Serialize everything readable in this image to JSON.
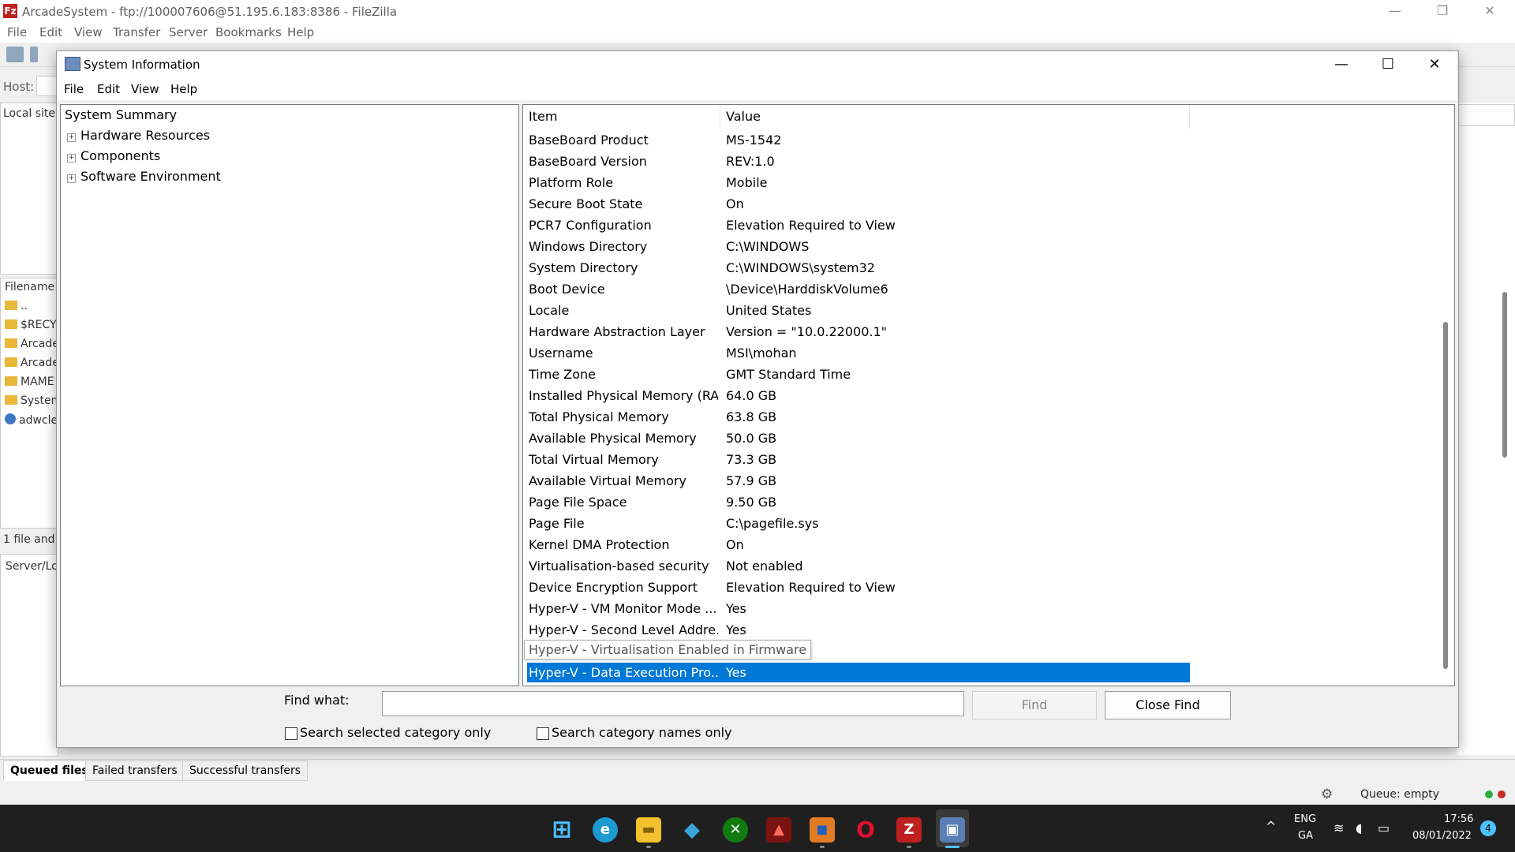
{
  "filezilla": {
    "title": "ArcadeSystem - ftp://100007606@51.195.6.183:8386 - FileZilla",
    "logo": "Fz",
    "window_controls": [
      "—",
      "❐",
      "✕"
    ],
    "menu": [
      "File",
      "Edit",
      "View",
      "Transfer",
      "Server",
      "Bookmarks",
      "Help"
    ],
    "host_label": "Host:",
    "local_site_label": "Local site:",
    "filename_header": "Filename",
    "files": [
      "..",
      "$RECYC",
      "Arcade",
      "Arcade",
      "MAME",
      "System",
      "adwcle"
    ],
    "status_left": "1 file and",
    "server_local_label": "Server/Lo",
    "transfer_tabs": [
      "Queued files",
      "Failed transfers",
      "Successful transfers"
    ],
    "queue_status": "Queue: empty",
    "queue_icon": "gear-icon",
    "led_colors": [
      "#2eae3f",
      "#c62828"
    ]
  },
  "sysinfo": {
    "title": "System Information",
    "window_controls": [
      "—",
      "☐",
      "✕"
    ],
    "menu": [
      "File",
      "Edit",
      "View",
      "Help"
    ],
    "tree": {
      "root": "System Summary",
      "children": [
        "Hardware Resources",
        "Components",
        "Software Environment"
      ],
      "expander": "+"
    },
    "columns": {
      "item": "Item",
      "value": "Value"
    },
    "rows": [
      {
        "item": "BaseBoard Product",
        "value": "MS-1542"
      },
      {
        "item": "BaseBoard Version",
        "value": "REV:1.0"
      },
      {
        "item": "Platform Role",
        "value": "Mobile"
      },
      {
        "item": "Secure Boot State",
        "value": "On"
      },
      {
        "item": "PCR7 Configuration",
        "value": "Elevation Required to View"
      },
      {
        "item": "Windows Directory",
        "value": "C:\\WINDOWS"
      },
      {
        "item": "System Directory",
        "value": "C:\\WINDOWS\\system32"
      },
      {
        "item": "Boot Device",
        "value": "\\Device\\HarddiskVolume6"
      },
      {
        "item": "Locale",
        "value": "United States"
      },
      {
        "item": "Hardware Abstraction Layer",
        "value": "Version = \"10.0.22000.1\""
      },
      {
        "item": "Username",
        "value": "MSI\\mohan"
      },
      {
        "item": "Time Zone",
        "value": "GMT Standard Time"
      },
      {
        "item": "Installed Physical Memory (RA...",
        "value": "64.0 GB"
      },
      {
        "item": "Total Physical Memory",
        "value": "63.8 GB"
      },
      {
        "item": "Available Physical Memory",
        "value": "50.0 GB"
      },
      {
        "item": "Total Virtual Memory",
        "value": "73.3 GB"
      },
      {
        "item": "Available Virtual Memory",
        "value": "57.9 GB"
      },
      {
        "item": "Page File Space",
        "value": "9.50 GB"
      },
      {
        "item": "Page File",
        "value": "C:\\pagefile.sys"
      },
      {
        "item": "Kernel DMA Protection",
        "value": "On"
      },
      {
        "item": "Virtualisation-based security",
        "value": "Not enabled"
      },
      {
        "item": "Device Encryption Support",
        "value": "Elevation Required to View"
      },
      {
        "item": "Hyper-V - VM Monitor Mode ...",
        "value": "Yes"
      },
      {
        "item": "Hyper-V - Second Level Addre...",
        "value": "Yes"
      },
      {
        "item": "",
        "value": ""
      },
      {
        "item": "Hyper-V - Data Execution Pro...",
        "value": "Yes",
        "selected": true
      }
    ],
    "tooltip": "Hyper-V - Virtualisation Enabled in Firmware",
    "selection_color": "#0078d7",
    "find": {
      "label": "Find what:",
      "value": "",
      "find_button": "Find",
      "close_find_button": "Close Find",
      "checkbox_selected_category": "Search selected category only",
      "checkbox_category_names": "Search category names only"
    }
  },
  "taskbar": {
    "apps": [
      {
        "name": "start-icon",
        "glyph": "⊞",
        "color": "#4cc2ff"
      },
      {
        "name": "edge-icon",
        "glyph": "e",
        "color": "#1d9bd1"
      },
      {
        "name": "file-explorer-icon",
        "glyph": "▬",
        "color": "#f2c12e"
      },
      {
        "name": "kodi-icon",
        "glyph": "◆",
        "color": "#3aa5d8"
      },
      {
        "name": "xbox-icon",
        "glyph": "✕",
        "color": "#107c10"
      },
      {
        "name": "game-icon",
        "glyph": "▲",
        "color": "#c0201a"
      },
      {
        "name": "rubik-icon",
        "glyph": "◼",
        "color": "#e27b24"
      },
      {
        "name": "opera-icon",
        "glyph": "O",
        "color": "#e0102c"
      },
      {
        "name": "filezilla-icon",
        "glyph": "Z",
        "color": "#bf1f1f"
      },
      {
        "name": "system-information-icon",
        "glyph": "▣",
        "color": "#5a7fb5"
      }
    ],
    "tray_chevron": "^",
    "language_top": "ENG",
    "language_bottom": "GA",
    "tray_icons": [
      "wifi-icon",
      "volume-icon",
      "battery-icon"
    ],
    "time": "17:56",
    "date": "08/01/2022",
    "notification_count": "4"
  }
}
